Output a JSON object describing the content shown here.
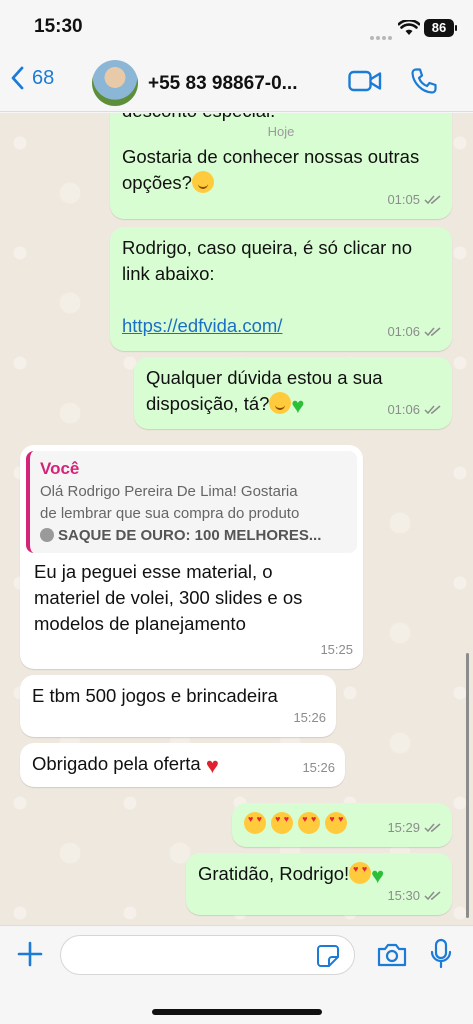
{
  "status_bar": {
    "time": "15:30",
    "battery": "86"
  },
  "header": {
    "back_count": "68",
    "contact": "+55 83 98867-0..."
  },
  "chat": {
    "date_label": "Hoje",
    "top_partial": "desconto especial.",
    "messages": [
      {
        "id": "m1",
        "direction": "out",
        "text": "Gostaria de conhecer nossas outras opções?",
        "time": "01:05"
      },
      {
        "id": "m2",
        "direction": "out",
        "text": "Rodrigo, caso queira, é só clicar no link abaixo:",
        "link": "https://edfvida.com/",
        "time": "01:06"
      },
      {
        "id": "m3",
        "direction": "out",
        "text": "Qualquer dúvida estou a sua disposição, tá?",
        "time": "01:06"
      },
      {
        "id": "m4",
        "direction": "in",
        "quote": {
          "author": "Você",
          "line1": "Olá Rodrigo Pereira De Lima! Gostaria",
          "line2": "de lembrar que sua compra do produto",
          "line3": "SAQUE DE OURO: 100 MELHORES..."
        },
        "text": "Eu ja peguei esse material, o materiel de volei, 300 slides e os modelos de planejamento",
        "time": "15:25"
      },
      {
        "id": "m5",
        "direction": "in",
        "text": "E tbm 500 jogos e brincadeira",
        "time": "15:26"
      },
      {
        "id": "m6",
        "direction": "in",
        "text": "Obrigado pela oferta",
        "time": "15:26"
      },
      {
        "id": "m7",
        "direction": "out",
        "text": "",
        "time": "15:29"
      },
      {
        "id": "m8",
        "direction": "out",
        "text": "Gratidão, Rodrigo!",
        "time": "15:30"
      }
    ]
  },
  "input": {
    "placeholder": ""
  },
  "colors": {
    "outgoing": "#d9fdd3",
    "incoming": "#ffffff",
    "accent": "#1b7bd6",
    "quote_author": "#d4247a"
  }
}
